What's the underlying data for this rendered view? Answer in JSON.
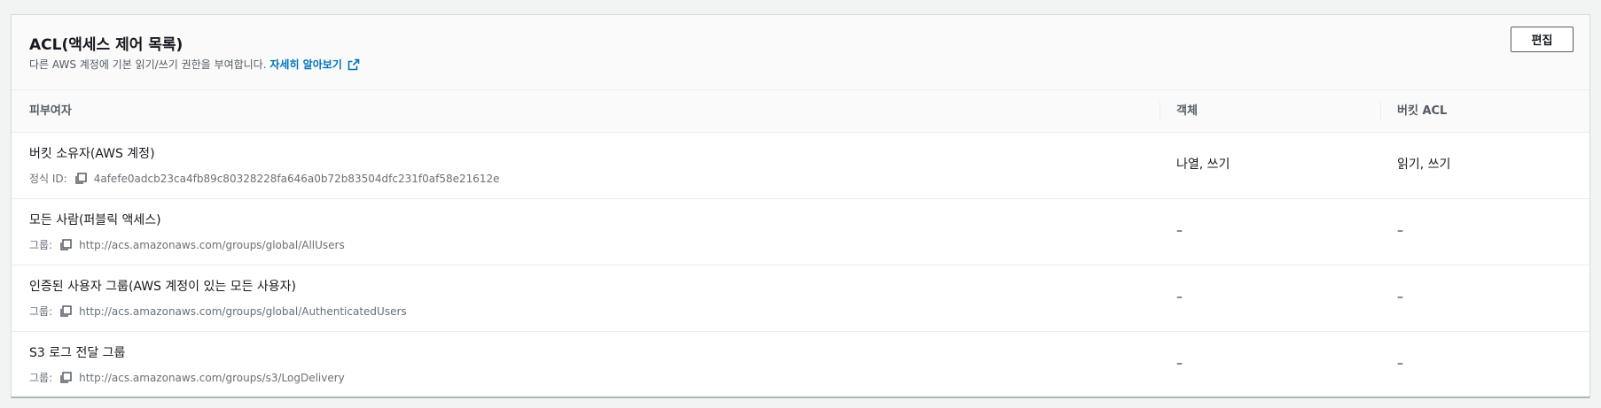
{
  "panel": {
    "title": "ACL(액세스 제어 목록)",
    "description": "다른 AWS 계정에 기본 읽기/쓰기 권한을 부여합니다.",
    "learn_more": "자세히 알아보기",
    "edit_button": "편집"
  },
  "table": {
    "columns": [
      "피부여자",
      "객체",
      "버킷 ACL"
    ],
    "rows": [
      {
        "grantee": "버킷 소유자(AWS 계정)",
        "meta_label": "정식 ID:",
        "meta_value": "4afefe0adcb23ca4fb89c80328228fa646a0b72b83504dfc231f0af58e21612e",
        "object": "나열, 쓰기",
        "bucket_acl": "읽기, 쓰기"
      },
      {
        "grantee": "모든 사람(퍼블릭 액세스)",
        "meta_label": "그룹:",
        "meta_value": "http://acs.amazonaws.com/groups/global/AllUsers",
        "object": "–",
        "bucket_acl": "–"
      },
      {
        "grantee": "인증된 사용자 그룹(AWS 계정이 있는 모든 사용자)",
        "meta_label": "그룹:",
        "meta_value": "http://acs.amazonaws.com/groups/global/AuthenticatedUsers",
        "object": "–",
        "bucket_acl": "–"
      },
      {
        "grantee": "S3 로그 전달 그룹",
        "meta_label": "그룹:",
        "meta_value": "http://acs.amazonaws.com/groups/s3/LogDelivery",
        "object": "–",
        "bucket_acl": "–"
      }
    ]
  },
  "colors": {
    "link": "#0073bb",
    "text": "#16191f",
    "muted": "#687078"
  },
  "icons": {
    "external_link": "external-link-icon",
    "copy": "copy-icon"
  }
}
